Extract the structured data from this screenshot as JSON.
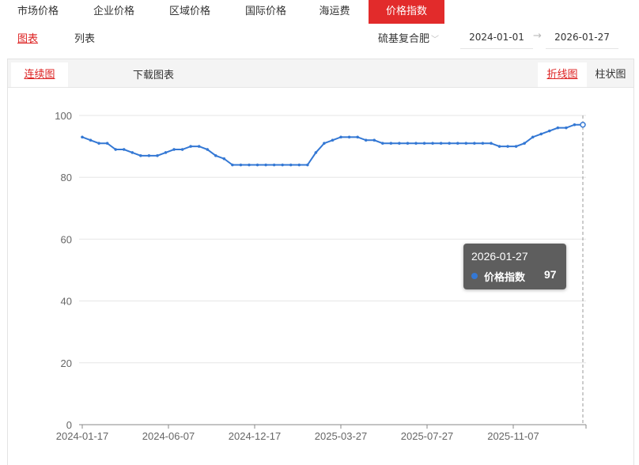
{
  "top_tabs": [
    {
      "label": "市场价格",
      "active": false
    },
    {
      "label": "企业价格",
      "active": false
    },
    {
      "label": "区域价格",
      "active": false
    },
    {
      "label": "国际价格",
      "active": false
    },
    {
      "label": "海运费",
      "active": false
    },
    {
      "label": "价格指数",
      "active": true
    }
  ],
  "view_tabs": [
    {
      "label": "图表",
      "active": true
    },
    {
      "label": "列表",
      "active": false
    }
  ],
  "filters": {
    "product": "硫基复合肥",
    "start_date": "2024-01-01",
    "end_date": "2026-01-27"
  },
  "toolbar": {
    "continuous_chart": "连续图",
    "download": "下载图表",
    "line_chart": "折线图",
    "bar_chart": "柱状图"
  },
  "tooltip": {
    "date": "2026-01-27",
    "series_name": "价格指数",
    "value": "97"
  },
  "colors": {
    "accent": "#e22b2b",
    "line": "#3478d4"
  },
  "chart_data": {
    "type": "line",
    "ylim": [
      0,
      100
    ],
    "yticks": [
      "0",
      "20",
      "40",
      "60",
      "80",
      "100"
    ],
    "xticks": [
      "2024-01-17",
      "2024-06-07",
      "2024-12-17",
      "2025-03-27",
      "2025-07-27",
      "2025-11-07"
    ],
    "series": [
      {
        "name": "价格指数",
        "values": [
          93,
          92,
          91,
          91,
          89,
          89,
          88,
          87,
          87,
          87,
          88,
          89,
          89,
          90,
          90,
          89,
          87,
          86,
          84,
          84,
          84,
          84,
          84,
          84,
          84,
          84,
          84,
          84,
          88,
          91,
          92,
          93,
          93,
          93,
          92,
          92,
          91,
          91,
          91,
          91,
          91,
          91,
          91,
          91,
          91,
          91,
          91,
          91,
          91,
          91,
          90,
          90,
          90,
          91,
          93,
          94,
          95,
          96,
          96,
          97,
          97
        ]
      }
    ]
  }
}
